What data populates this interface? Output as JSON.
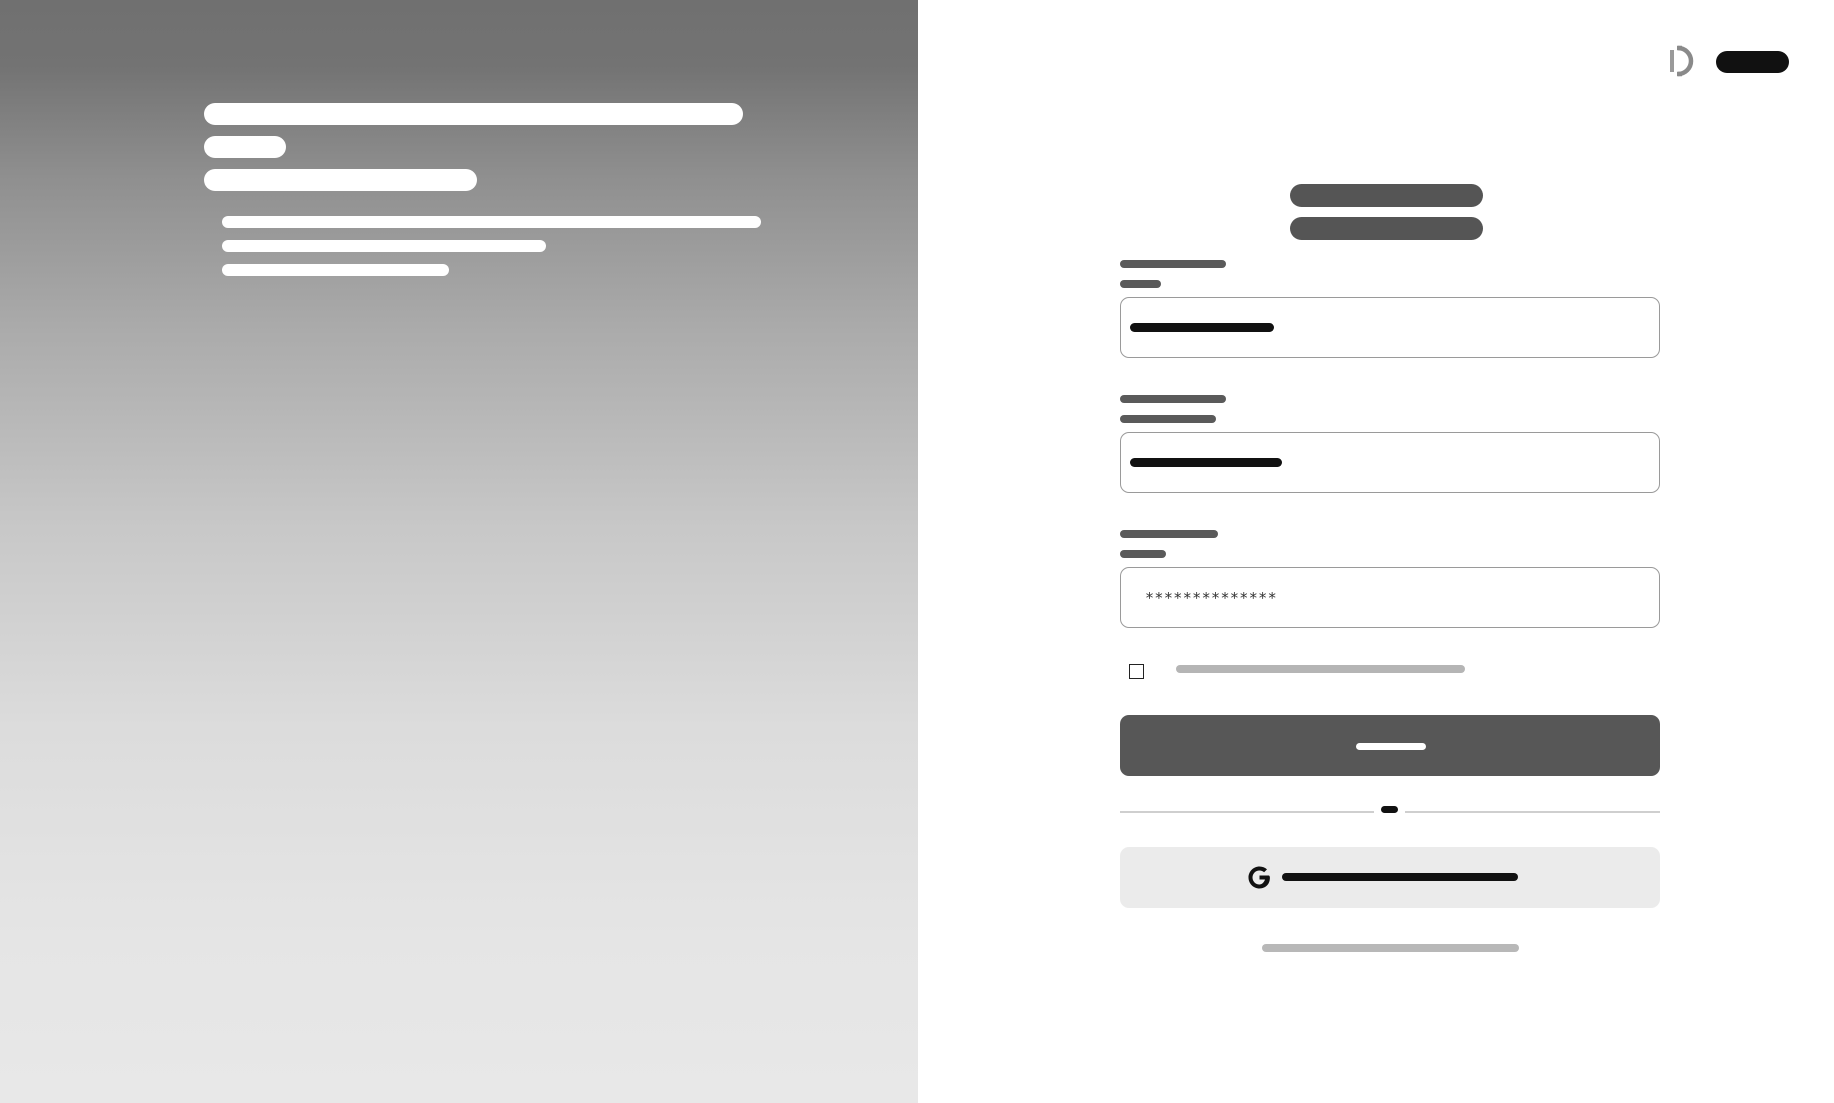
{
  "form": {
    "password_value": "**************"
  },
  "colors": {
    "panel_gradient_top": "#707070",
    "panel_gradient_bottom": "#e8e8e8",
    "primary_button": "#575757",
    "secondary_button": "#ebebeb",
    "ink": "#111111"
  },
  "icons": {
    "logo": "brand-logo-icon",
    "google": "google-icon"
  }
}
